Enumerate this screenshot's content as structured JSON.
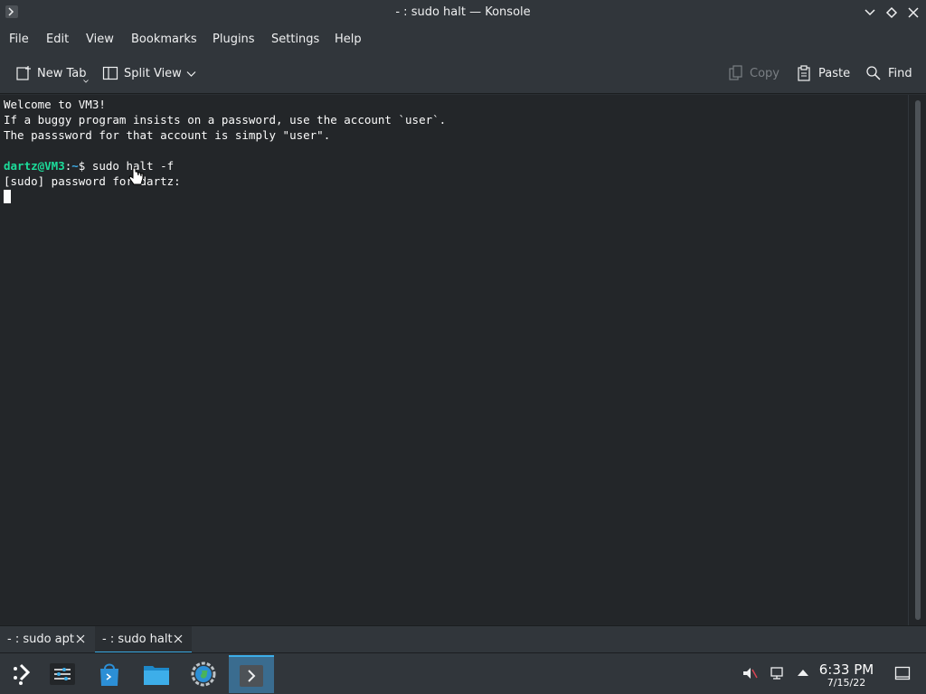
{
  "window": {
    "title": "- : sudo halt — Konsole"
  },
  "menu": {
    "file": "File",
    "edit": "Edit",
    "view": "View",
    "bookmarks": "Bookmarks",
    "plugins": "Plugins",
    "settings": "Settings",
    "help": "Help"
  },
  "toolbar": {
    "new_tab": "New Tab",
    "split_view": "Split View",
    "copy": "Copy",
    "paste": "Paste",
    "find": "Find"
  },
  "terminal": {
    "line1": "Welcome to VM3!",
    "line2": "If a buggy program insists on a password, use the account `user`.",
    "line3": "The passsword for that account is simply \"user\".",
    "prompt_user": "dartz@VM3",
    "prompt_sep": ":",
    "prompt_path": "~",
    "prompt_symbol": "$ ",
    "command": "sudo halt -f",
    "sudo_prompt": "[sudo] password for dartz:"
  },
  "tabs": [
    {
      "label": "- : sudo apt"
    },
    {
      "label": "- : sudo halt"
    }
  ],
  "taskbar": {
    "time": "6:33 PM",
    "date": "7/15/22"
  },
  "colors": {
    "accent": "#3daee9",
    "prompt_user": "#1cdc9a",
    "terminal_bg": "#232629"
  }
}
